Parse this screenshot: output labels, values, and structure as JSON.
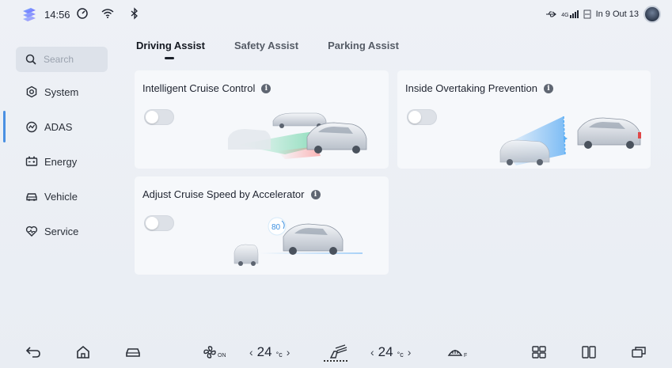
{
  "status_bar": {
    "time": "14:56",
    "date": "In 9 Out 13",
    "signal_label": "4G"
  },
  "sidebar": {
    "search_placeholder": "Search",
    "items": [
      {
        "label": "System",
        "icon": "gear-icon"
      },
      {
        "label": "ADAS",
        "icon": "speedometer-icon",
        "active": true
      },
      {
        "label": "Energy",
        "icon": "battery-icon"
      },
      {
        "label": "Vehicle",
        "icon": "car-icon"
      },
      {
        "label": "Service",
        "icon": "heart-icon"
      }
    ]
  },
  "tabs": [
    {
      "label": "Driving Assist",
      "active": true
    },
    {
      "label": "Safety Assist",
      "active": false
    },
    {
      "label": "Parking Assist",
      "active": false
    }
  ],
  "cards": [
    {
      "title": "Intelligent Cruise Control",
      "toggle_on": false
    },
    {
      "title": "Inside Overtaking Prevention",
      "toggle_on": false
    },
    {
      "title": "Adjust Cruise Speed by Accelerator",
      "toggle_on": false,
      "speed_badge": "80"
    }
  ],
  "bottom_bar": {
    "fan_label": "ON",
    "left_temp": "24",
    "right_temp": "24",
    "temp_unit": "°c",
    "defrost_label": "F"
  },
  "colors": {
    "accent": "#4a90e2",
    "background": "#eef1f6",
    "card": "#f6f8fb",
    "toggle_off": "#dde1e7"
  }
}
